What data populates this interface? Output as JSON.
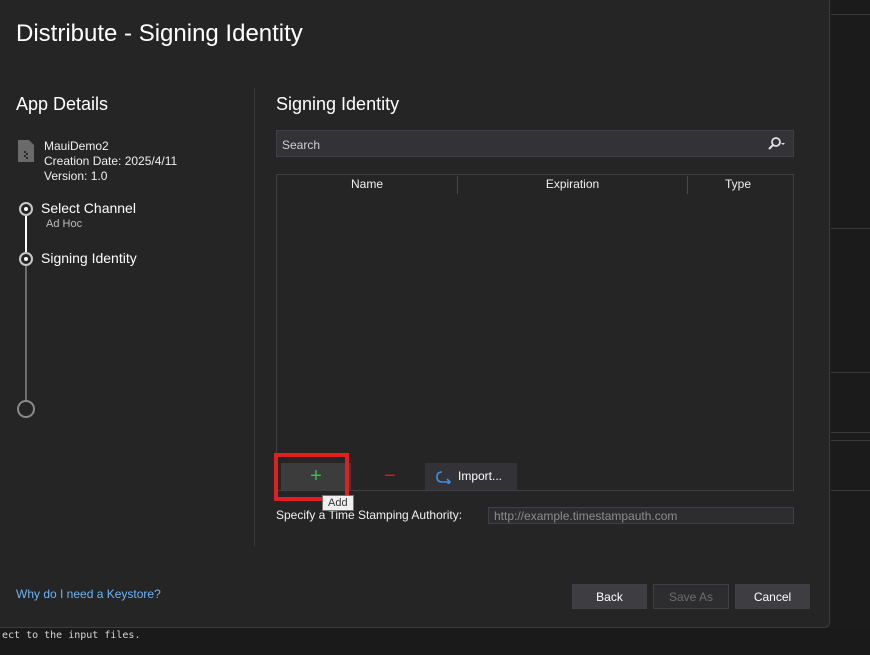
{
  "dialog": {
    "title": "Distribute - Signing Identity"
  },
  "left": {
    "heading": "App Details",
    "app": {
      "name": "MauiDemo2",
      "creation_date": "Creation Date: 2025/4/11",
      "version": "Version: 1.0"
    },
    "steps": [
      {
        "label": "Select Channel",
        "sub": "Ad Hoc",
        "state": "done"
      },
      {
        "label": "Signing Identity",
        "sub": "",
        "state": "current"
      },
      {
        "label": "",
        "sub": "",
        "state": "pending"
      }
    ],
    "keystore_link": "Why do I need a Keystore?"
  },
  "right": {
    "heading": "Signing Identity",
    "search": {
      "placeholder": "Search",
      "icon": "search-icon"
    },
    "table": {
      "columns": [
        "Name",
        "Expiration",
        "Type"
      ],
      "rows": []
    },
    "toolbar": {
      "add_label": "+",
      "remove_label": "−",
      "import_label": "Import...",
      "add_tooltip": "Add"
    },
    "tsa": {
      "label": "Specify a Time Stamping Authority:",
      "placeholder": "http://example.timestampauth.com"
    }
  },
  "buttons": {
    "back": "Back",
    "save_as": "Save As",
    "cancel": "Cancel",
    "save_as_enabled": false
  },
  "background": {
    "console_text": "ect to the input files."
  },
  "colors": {
    "accent_link": "#6eb3f7",
    "add": "#3fb950",
    "remove": "#e81123",
    "highlight": "#e02020"
  }
}
